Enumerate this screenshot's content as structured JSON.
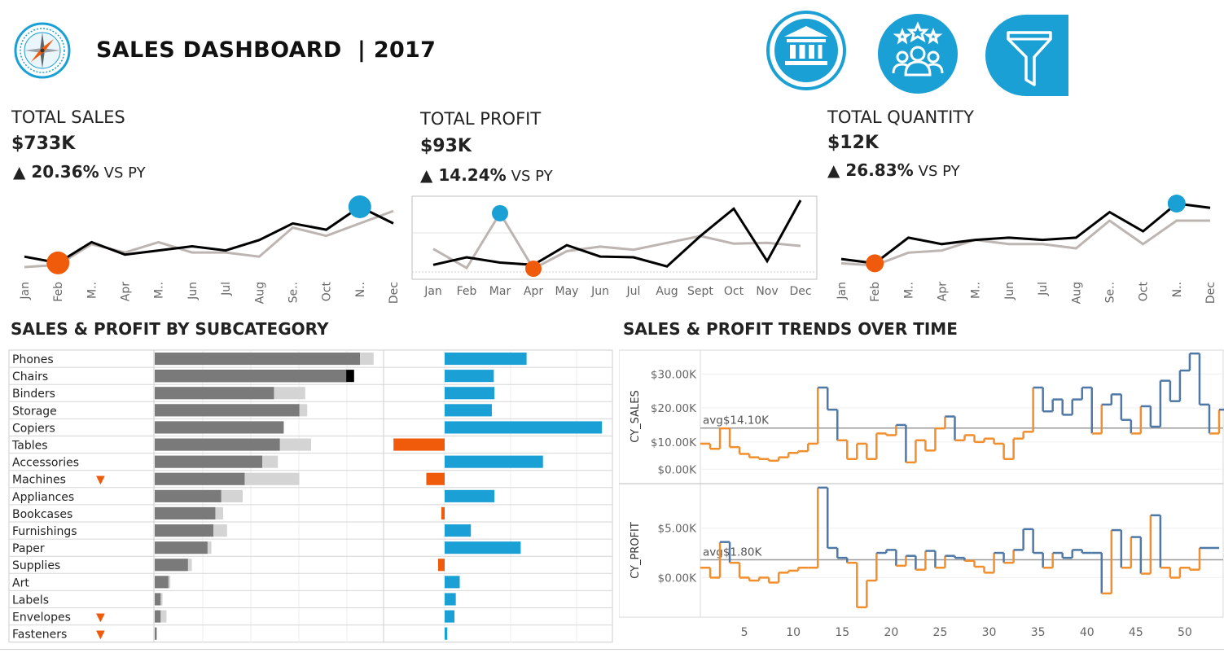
{
  "header": {
    "title": "SALES DASHBOARD",
    "year_sep": "| 2017"
  },
  "icons": {
    "logo": "compass-icon",
    "bank_button": "bank-icon",
    "customers_button": "customers-icon",
    "filter_button": "filter-icon",
    "accent": "#1aa0d4"
  },
  "kpis": [
    {
      "title": "TOTAL SALES",
      "value": "$733K",
      "arrow": "▲",
      "change": "20.36%",
      "vs": "VS PY",
      "months": [
        "Jan",
        "Feb",
        "M..",
        "Apr",
        "M..",
        "Jun",
        "Jul",
        "Aug",
        "Se..",
        "Oct",
        "N..",
        "Dec"
      ],
      "cy": [
        8,
        5,
        15,
        9,
        11,
        13,
        11,
        16,
        24,
        21,
        32,
        24
      ],
      "py": [
        3,
        4,
        14,
        10,
        15,
        10,
        10,
        8,
        22,
        18,
        24,
        30
      ],
      "max_index": 10,
      "min_index": 1
    },
    {
      "title": "TOTAL PROFIT",
      "value": "$93K",
      "arrow": "▲",
      "change": "14.24%",
      "vs": "VS PY",
      "months": [
        "Jan",
        "Feb",
        "Mar",
        "Apr",
        "May",
        "Jun",
        "Jul",
        "Aug",
        "Sept",
        "Oct",
        "Nov",
        "Dec"
      ],
      "cy": [
        2,
        3,
        2.3,
        2,
        4.6,
        3.1,
        3,
        1.8,
        5.8,
        9.4,
        2.5,
        10.5
      ],
      "py": [
        4.1,
        1.6,
        8.8,
        1.5,
        3.8,
        4.4,
        4,
        4.9,
        5.8,
        4.8,
        4.9,
        4.5
      ],
      "max_index": 2,
      "min_index": 3
    },
    {
      "title": "TOTAL QUANTITY",
      "value": "$12K",
      "arrow": "▲",
      "change": "26.83%",
      "vs": "VS PY",
      "months": [
        "Jan",
        "Feb",
        "M..",
        "Apr",
        "M..",
        "Jun",
        "Jul",
        "Aug",
        "Se..",
        "Oct",
        "N..",
        "Dec"
      ],
      "cy": [
        4,
        2,
        14,
        11,
        13,
        14,
        13,
        14,
        26,
        17,
        30,
        28
      ],
      "py": [
        2,
        1,
        7,
        8,
        13,
        11,
        11,
        9,
        22,
        11,
        22,
        22
      ],
      "max_index": 10,
      "min_index": 1
    }
  ],
  "sections": {
    "subcategory_title": "SALES & PROFIT BY SUBCATEGORY",
    "trends_title": "SALES & PROFIT TRENDS OVER TIME"
  },
  "chart_data": [
    {
      "type": "bar",
      "categories": [
        "Phones",
        "Chairs",
        "Binders",
        "Storage",
        "Copiers",
        "Tables",
        "Accessories",
        "Machines",
        "Appliances",
        "Bookcases",
        "Furnishings",
        "Paper",
        "Supplies",
        "Art",
        "Labels",
        "Envelopes",
        "Fasteners"
      ],
      "series": [
        {
          "values": [
            105,
            102,
            61,
            74,
            66,
            64,
            55,
            46,
            34,
            31,
            30,
            27,
            17,
            7,
            3,
            3,
            1
          ]
        },
        {
          "values": [
            112,
            98,
            77,
            78,
            66,
            80,
            63,
            74,
            45,
            35,
            37,
            29,
            19,
            8,
            4,
            6,
            1
          ]
        },
        {
          "values": [
            12.5,
            7.5,
            7.6,
            7.2,
            24,
            -7.8,
            15,
            -2.8,
            7.6,
            -0.5,
            4,
            11.6,
            -1,
            2.3,
            1.7,
            1.5,
            0.4
          ]
        }
      ],
      "flags": [
        false,
        false,
        false,
        false,
        false,
        false,
        false,
        true,
        false,
        false,
        false,
        false,
        false,
        false,
        false,
        true,
        true
      ],
      "flag_symbol": "▼",
      "colors": {
        "current": "#7a7a7a",
        "previous": "#d4d4d4",
        "growth": "#000000",
        "profit_pos": "#1aa0d4",
        "profit_neg": "#f05a0b"
      }
    },
    {
      "type": "line",
      "x_ticks": [
        "5",
        "10",
        "15",
        "20",
        "25",
        "30",
        "35",
        "40",
        "45",
        "50"
      ],
      "x_tick_values": [
        5,
        10,
        15,
        20,
        25,
        30,
        35,
        40,
        45,
        50
      ],
      "panels": [
        {
          "ylabel": "CY_SALES",
          "y_ticks": [
            "$30.00K",
            "$20.00K",
            "$10.00K",
            "$0.00K"
          ],
          "y_tick_values": [
            30,
            20,
            10,
            2
          ],
          "ylim": [
            -2,
            37
          ],
          "avg": 14.1,
          "avg_label": "avg$14.10K",
          "values": [
            9.5,
            8,
            14,
            8.5,
            6.5,
            5.5,
            5,
            4.5,
            5.5,
            6.8,
            7.3,
            9.5,
            26,
            19.5,
            10.5,
            5,
            9.5,
            5,
            12.5,
            12,
            15,
            4,
            10.5,
            7.5,
            14,
            17.5,
            10.5,
            12,
            10,
            11,
            9.5,
            5,
            11,
            13,
            26,
            19,
            22.5,
            18,
            22.5,
            26,
            12.5,
            21,
            24,
            16.5,
            12.5,
            20.5,
            14.5,
            28,
            22,
            31,
            36,
            21,
            12.5,
            19.5,
            14.5
          ]
        },
        {
          "ylabel": "CY_PROFIT",
          "y_ticks": [
            "$5.00K",
            "$0.00K"
          ],
          "y_tick_values": [
            5,
            0
          ],
          "ylim": [
            -4,
            9.5
          ],
          "avg": 1.8,
          "avg_label": "avg$1.80K",
          "values": [
            1,
            0,
            3.6,
            1.5,
            0,
            -0.3,
            0,
            -0.5,
            0.5,
            0.7,
            1,
            1,
            9.1,
            3,
            2,
            1.5,
            -3,
            -0.3,
            2.5,
            2.8,
            1.2,
            2.2,
            0.8,
            2.7,
            1,
            2.2,
            2,
            1.7,
            1.1,
            0.5,
            2.5,
            1.5,
            2.8,
            4.9,
            2.5,
            1,
            2.5,
            2,
            2.8,
            2.5,
            2.5,
            -1.6,
            4.8,
            1,
            4.1,
            0.4,
            6.3,
            1,
            0,
            1,
            0.8,
            3,
            3
          ]
        }
      ],
      "colors": {
        "above": "#4e79a7",
        "below": "#f28e2b",
        "avg_line": "#9a9a9a"
      }
    }
  ],
  "colors": {
    "max_dot": "#1aa0d4",
    "min_dot": "#f05a0b",
    "cy_line": "#000000",
    "py_line": "#bdb5b2"
  }
}
